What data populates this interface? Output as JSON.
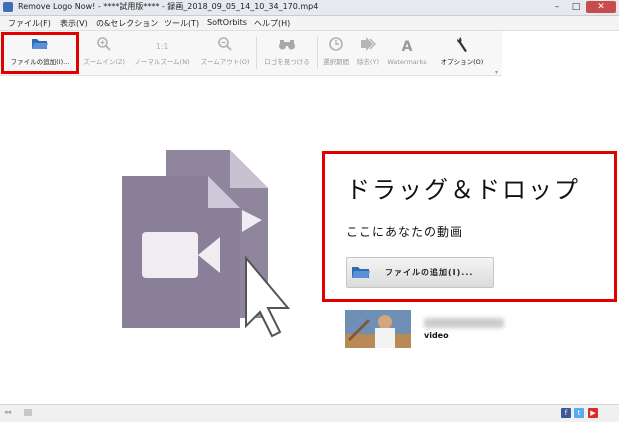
{
  "window": {
    "title": "Remove Logo Now! - ****試用版**** - 録画_2018_09_05_14_10_34_170.mp4",
    "min": "–",
    "max": "□",
    "close": "✕"
  },
  "menu": [
    "ファイル(F)",
    "表示(V)",
    "の&セレクション",
    "ツール(T)",
    "SoftOrbits",
    "ヘルプ(H)"
  ],
  "toolbar": {
    "add_file": "ファイルの追加(I)...",
    "zoom_in": "ズームイン(Z)",
    "normal_zoom_icon": "1:1",
    "normal_zoom": "ノーマルズーム(N)",
    "zoom_out": "ズームアウト(O)",
    "find_logo": "ロゴを見つける",
    "select_time": "選択期間",
    "remove": "除去(Y)",
    "watermarks": "Watermarks",
    "options": "オプション(O)"
  },
  "dropzone": {
    "title": "ドラッグ＆ドロップ",
    "subtitle": "ここにあなたの動画",
    "add_file_label": "ファイルの追加(I)..."
  },
  "recent": {
    "caption": "video"
  },
  "colors": {
    "highlight": "#e00000",
    "illustration": "#8a7f98",
    "illustration_dark": "#6c6179"
  },
  "icons": {
    "folder": "folder-open-icon",
    "zoom_in": "zoom-in-icon",
    "zoom_out": "zoom-out-icon",
    "binoculars": "binoculars-icon",
    "clock": "clock-icon",
    "arrow": "arrow-right-icon",
    "watermark": "watermark-a-icon",
    "wrench": "wrench-icon"
  }
}
